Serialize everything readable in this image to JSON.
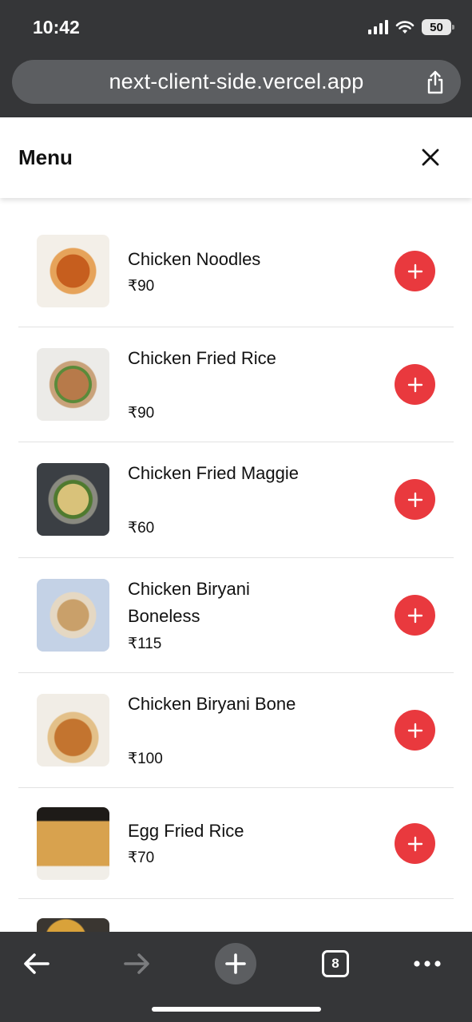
{
  "status_bar": {
    "time": "10:42",
    "battery": "50"
  },
  "browser": {
    "url": "next-client-side.vercel.app",
    "tabs_count": "8"
  },
  "page": {
    "title": "Menu"
  },
  "menu_items": [
    {
      "name": "Chicken Noodles",
      "price": "₹90"
    },
    {
      "name": "Chicken Fried Rice",
      "price": "₹90"
    },
    {
      "name": "Chicken Fried Maggie",
      "price": "₹60"
    },
    {
      "name": "Chicken Biryani Boneless",
      "price": "₹115"
    },
    {
      "name": "Chicken Biryani Bone",
      "price": "₹100"
    },
    {
      "name": "Egg Fried Rice",
      "price": "₹70"
    }
  ],
  "icons": {
    "add": "plus-icon",
    "close": "close-icon",
    "share": "share-icon",
    "back": "arrow-left-icon",
    "forward": "arrow-right-icon",
    "new_tab": "plus-icon",
    "more": "more-dots-icon"
  },
  "colors": {
    "accent": "#e9393e",
    "chrome": "#353638",
    "url_bar": "#5c5e61"
  }
}
